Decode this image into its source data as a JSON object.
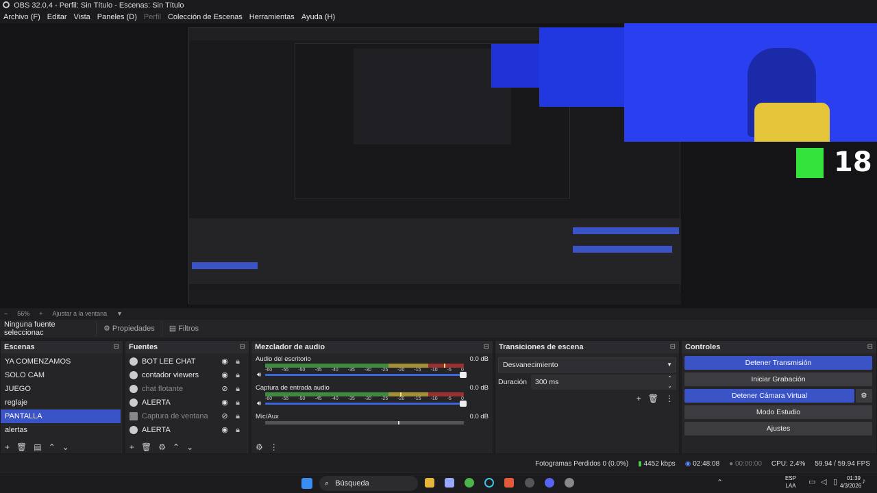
{
  "window": {
    "title": "OBS 32.0.4 - Perfil: Sin Título - Escenas: Sin Título"
  },
  "menu": {
    "items": [
      "Archivo (F)",
      "Editar",
      "Vista",
      "Paneles (D)",
      "Perfil",
      "Colección de Escenas",
      "Herramientas",
      "Ayuda (H)"
    ],
    "disabled_index": 4
  },
  "preview": {
    "zoom": "56%",
    "fit_label": "Ajustar a la ventana",
    "overlay_text": "18"
  },
  "properties_bar": {
    "no_selection": "Ninguna fuente seleccionac",
    "properties": "Propiedades",
    "filters": "Filtros"
  },
  "scenes": {
    "title": "Escenas",
    "items": [
      "YA COMENZAMOS",
      "SOLO CAM",
      "JUEGO",
      "reglaje",
      "PANTALLA",
      "alertas"
    ],
    "selected_index": 4
  },
  "sources": {
    "title": "Fuentes",
    "items": [
      {
        "name": "BOT LEE CHAT",
        "icon": "browser-icon",
        "visible": true
      },
      {
        "name": "contador viewers",
        "icon": "browser-icon",
        "visible": true
      },
      {
        "name": "chat flotante",
        "icon": "browser-icon",
        "visible": false
      },
      {
        "name": "ALERTA",
        "icon": "browser-icon",
        "visible": true
      },
      {
        "name": "Captura de ventana",
        "icon": "window-icon",
        "visible": false
      },
      {
        "name": "ALERTA",
        "icon": "browser-icon",
        "visible": true
      }
    ]
  },
  "mixer": {
    "title": "Mezclador de audio",
    "channels": [
      {
        "name": "Audio del escritorio",
        "db": "0.0 dB",
        "level": 0.9
      },
      {
        "name": "Captura de entrada audio",
        "db": "0.0 dB",
        "level": 0.68
      },
      {
        "name": "Mic/Aux",
        "db": "0.0 dB",
        "level": 0.67
      }
    ],
    "scale": [
      "-60",
      "-55",
      "-50",
      "-45",
      "-40",
      "-35",
      "-30",
      "-25",
      "-20",
      "-15",
      "-10",
      "-5",
      "0"
    ]
  },
  "transitions": {
    "title": "Transiciones de escena",
    "selected": "Desvanecimiento",
    "duration_label": "Duración",
    "duration_value": "300 ms"
  },
  "controls": {
    "title": "Controles",
    "buttons": [
      {
        "label": "Detener Transmisión",
        "active": true
      },
      {
        "label": "Iniciar Grabación",
        "active": false
      },
      {
        "label": "Detener Cámara Virtual",
        "active": true
      },
      {
        "label": "Modo Estudio",
        "active": false
      },
      {
        "label": "Ajustes",
        "active": false
      }
    ]
  },
  "status": {
    "dropped_frames": "Fotogramas Perdidos 0 (0.0%)",
    "bitrate": "4452 kbps",
    "stream_time": "02:48:08",
    "rec_time": "00:00:00",
    "cpu": "CPU: 2.4%",
    "fps": "59.94 / 59.94 FPS"
  },
  "taskbar": {
    "search": "Búsqueda",
    "lang_top": "ESP",
    "lang_bottom": "LAA",
    "time": "01:39",
    "date": "4/3/2026"
  },
  "colors": {
    "accent": "#3a54c8",
    "background": "#1e1e20",
    "panel": "#252528"
  }
}
